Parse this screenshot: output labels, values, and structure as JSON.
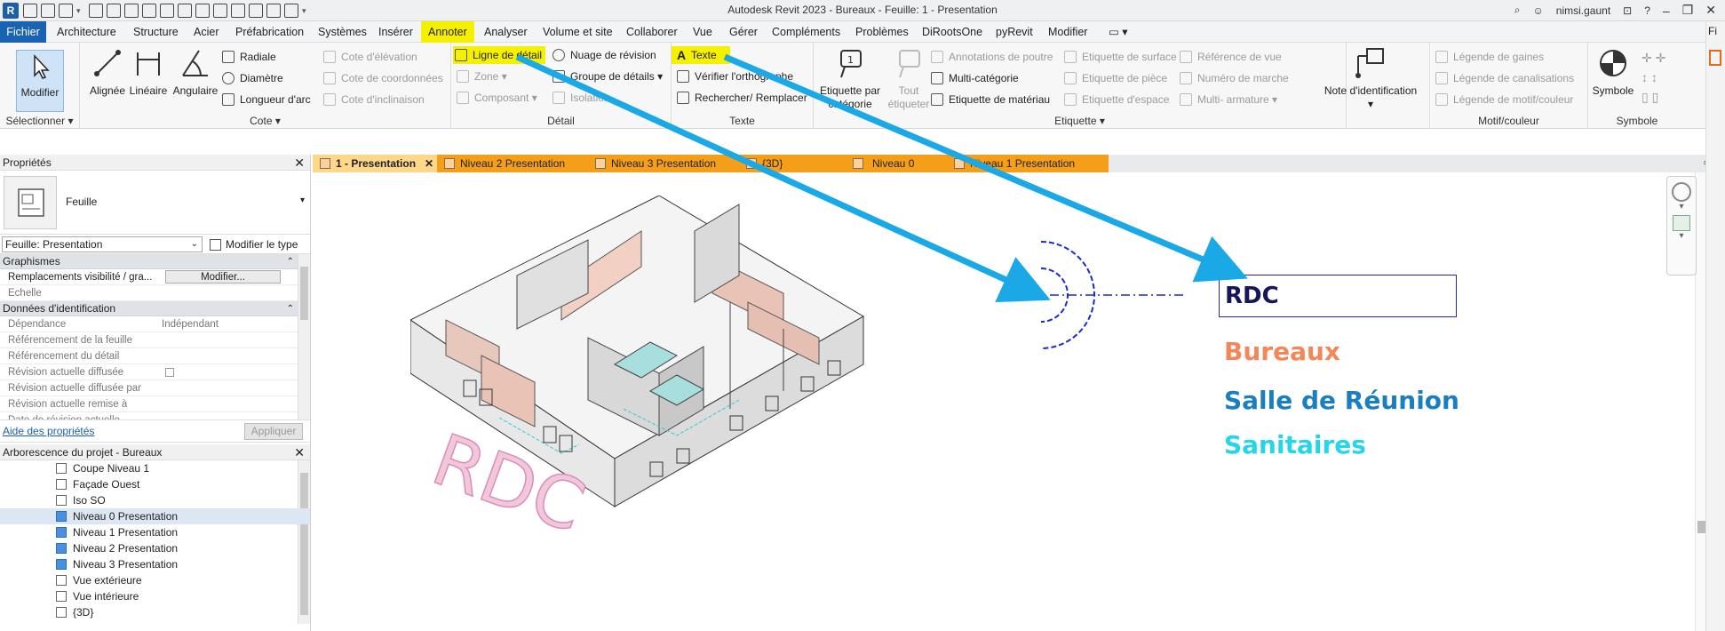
{
  "app": {
    "title": "Autodesk Revit 2023 - Bureaux - Feuille: 1 - Presentation",
    "logo_letter": "R",
    "user": "nimsi.gaunt",
    "edge_text": "Fi"
  },
  "menu": {
    "items": [
      "Fichier",
      "Architecture",
      "Structure",
      "Acier",
      "Préfabrication",
      "Systèmes",
      "Insérer",
      "Annoter",
      "Analyser",
      "Volume et site",
      "Collaborer",
      "Vue",
      "Gérer",
      "Compléments",
      "Problèmes",
      "DiRootsOne",
      "pyRevit",
      "Modifier"
    ],
    "highlighted": "Annoter"
  },
  "ribbon": {
    "select": {
      "modify": "Modifier",
      "label": "Sélectionner ▾"
    },
    "cote": {
      "buttons": [
        "Alignée",
        "Linéaire",
        "Angulaire"
      ],
      "small": [
        "Radiale",
        "Diamètre",
        "Longueur d'arc"
      ],
      "disabled": [
        "Cote d'élévation",
        "Cote de coordonnées",
        "Cote d'inclinaison"
      ],
      "label": "Cote ▾"
    },
    "detail": {
      "items": [
        "Ligne de détail",
        "Nuage de révision",
        "Zone",
        "Groupe de détails",
        "Composant",
        "Isolation"
      ],
      "label": "Détail"
    },
    "texte": {
      "items": [
        "Texte",
        "Vérifier l'orthographe",
        "Rechercher/ Remplacer"
      ],
      "label": "Texte"
    },
    "etiquette": {
      "big": [
        "Etiquette par catégorie",
        "Tout étiqueter"
      ],
      "items": [
        "Annotations de poutre",
        "Multi-catégorie",
        "Etiquette de matériau",
        "Etiquette de surface",
        "Etiquette de pièce",
        "Etiquette d'espace",
        "Référence de vue",
        "Numéro de marche",
        "Multi- armature"
      ],
      "label": "Etiquette ▾"
    },
    "note": {
      "label": "Note d'identification"
    },
    "motif": {
      "items": [
        "Légende de gaines",
        "Légende de canalisations",
        "Légende de motif/couleur"
      ],
      "label": "Motif/couleur"
    },
    "symbole": {
      "button": "Symbole",
      "label": "Symbole"
    }
  },
  "properties": {
    "title": "Propriétés",
    "type_name": "Feuille",
    "instance_select": "Feuille: Presentation",
    "edit_type": "Modifier le type",
    "sections": [
      {
        "name": "Graphismes",
        "rows": [
          {
            "key": "Remplacements visibilité / gra...",
            "value": "Modifier..."
          },
          {
            "key": "Echelle",
            "value": ""
          }
        ]
      },
      {
        "name": "Données d'identification",
        "rows": [
          {
            "key": "Dépendance",
            "value": "Indépendant"
          },
          {
            "key": "Référencement de la feuille",
            "value": ""
          },
          {
            "key": "Référencement du détail",
            "value": ""
          },
          {
            "key": "Révision actuelle diffusée",
            "value": ""
          },
          {
            "key": "Révision actuelle diffusée par",
            "value": ""
          },
          {
            "key": "Révision actuelle remise à",
            "value": ""
          },
          {
            "key": "Date de révision actuelle",
            "value": ""
          }
        ]
      }
    ],
    "help_link": "Aide des propriétés",
    "apply": "Appliquer"
  },
  "browser": {
    "title": "Arborescence du projet - Bureaux",
    "items": [
      "Coupe Niveau 1",
      "Façade Ouest",
      "Iso SO",
      "Niveau 0 Presentation",
      "Niveau 1 Presentation",
      "Niveau 2 Presentation",
      "Niveau 3 Presentation",
      "Vue extérieure",
      "Vue intérieure",
      "{3D}"
    ],
    "selected": "Niveau 0 Presentation"
  },
  "tabs": [
    "1 - Presentation",
    "Niveau 2 Presentation",
    "Niveau 3 Presentation",
    "{3D}",
    "Niveau 0",
    "Niveau 1 Presentation"
  ],
  "sheet": {
    "watermark": "RDC",
    "title_box": "RDC",
    "legend": [
      {
        "label": "Bureaux",
        "color": "#f4875a"
      },
      {
        "label": "Salle de Réunion",
        "color": "#1a7fc1"
      },
      {
        "label": "Sanitaires",
        "color": "#25d6e8"
      }
    ]
  },
  "colors": {
    "highlight": "#f5f000",
    "arrow": "#1aa8e6",
    "tab": "#f59e1a",
    "file_tab": "#1a63b3"
  }
}
